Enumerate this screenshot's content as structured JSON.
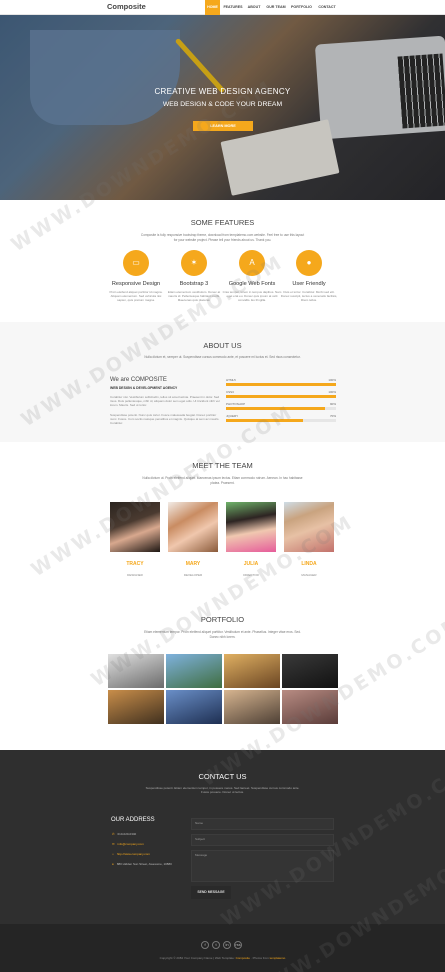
{
  "nav": {
    "brand": "Composite",
    "items": [
      "HOME",
      "FEATURES",
      "ABOUT",
      "OUR TEAM",
      "PORTFOLIO",
      "CONTACT"
    ]
  },
  "hero": {
    "title": "CREATIVE WEB DESIGN AGENCY",
    "subtitle": "WEB DESIGN & CODE YOUR DREAM",
    "button": "LEARN MORE"
  },
  "features": {
    "title": "SOME FEATURES",
    "text": "Composite is fully responsive bootstrap theme, download from templatemo.com website. Feel free to use this layout for your website project. Please tell your friends about us. Thank you.",
    "items": [
      {
        "icon": "laptop-icon",
        "glyph": "▭",
        "title": "Responsive Design",
        "text": "Proin eleifend aliquet porttitor id magna. Aliquam elementum. Sed vehicula nisi sapien, quis pretium magna."
      },
      {
        "icon": "star-icon",
        "glyph": "✶",
        "title": "Bootstrap 3",
        "text": "Etiam elementum vestibulum. Donec at mauris id. Pellentesque habitant morbi. Maecenas quis placerat."
      },
      {
        "icon": "font-icon",
        "glyph": "A",
        "title": "Google Web Fonts",
        "text": "Cras tempor, lorem in tempus dapibus. Nam eget erat eu. Donec quis ipsum at velit convallis. Eu fringilla."
      },
      {
        "icon": "user-icon",
        "glyph": "●",
        "title": "User Friendly",
        "text": "Duis et tortor. Curabitur. Morbi sed elit. Donec suscipit, lectus a venenatis facilisis, libero tellus."
      }
    ]
  },
  "about": {
    "title": "ABOUT US",
    "text": "Nulla dictum et, semper ut. Suspendisse cursus commodo ante, et posuere mi luctus et. Sed risus consectetur.",
    "heading": "We are COMPOSITE",
    "subheading": "WEB DESIGN & DEVELOPMENT AGENCY",
    "para1": "Curabitur nisi. Vestibulum sollicitudin, tellus sit amet lacinia. Praesent in dolor. Sed risus. Duis pellentesque, nibh id, aliquam dolor sem eget odio. Ut tincidunt nibh vel lorem. Mauris. Sed ut tortor.",
    "para2": "Suspendisse potenti. Nunc quis tortor. Fusce malesuada feugiat. Donec porttitor nunc. Fusce. Cum sociis natoque penatibus et magnis. Quisque at sem ac mauris. Curabitur.",
    "skills": [
      {
        "label": "HTML5",
        "pct": "100%",
        "value": 1.0
      },
      {
        "label": "CSS3",
        "pct": "100%",
        "value": 1.0
      },
      {
        "label": "PHOTOSHOP",
        "pct": "90%",
        "value": 0.9
      },
      {
        "label": "JQUERY",
        "pct": "70%",
        "value": 0.7
      }
    ]
  },
  "team": {
    "title": "MEET THE TEAM",
    "text": "Nulla dictum ut. Proin eleifend aliquet. Maecenas ipsum lectus. Etiam commodo rutrum. Aenean. In hac habitasse platea. Praesent.",
    "members": [
      {
        "name": "TRACY",
        "role": "DESIGNER"
      },
      {
        "name": "MARY",
        "role": "DEVELOPER"
      },
      {
        "name": "JULIA",
        "role": "DIRECTOR"
      },
      {
        "name": "LINDA",
        "role": "MANAGER"
      }
    ]
  },
  "portfolio": {
    "title": "PORTFOLIO",
    "text": "Etiam elementum tempor. Proin eleifend aliquet porttitor. Vestibulum et ante. Phasellus. Integer vitae eros. Sed. Donec nibh lorem.",
    "tiles": [
      {
        "icon": "laptop-photo",
        "colors": [
          "#e0e0e0",
          "#6b6b6b"
        ]
      },
      {
        "icon": "mountain-photo",
        "colors": [
          "#7fb2de",
          "#3f6d3f"
        ]
      },
      {
        "icon": "street-photo",
        "colors": [
          "#e0b062",
          "#6a4523"
        ]
      },
      {
        "icon": "keyboard-photo",
        "colors": [
          "#3a3a3a",
          "#111111"
        ]
      },
      {
        "icon": "sunset-photo",
        "colors": [
          "#c98e4a",
          "#40301f"
        ]
      },
      {
        "icon": "solar-photo",
        "colors": [
          "#6a8fc8",
          "#1e2f52"
        ]
      },
      {
        "icon": "city-photo",
        "colors": [
          "#d7b590",
          "#4e4035"
        ]
      },
      {
        "icon": "building-photo",
        "colors": [
          "#b88c83",
          "#5a3c39"
        ]
      }
    ]
  },
  "contact": {
    "title": "CONTACT US",
    "text": "Suspendisse potenti. Etiam elementum tempor, in posuere metus. Sed laoreet. Suspendisse cursus commodo ante. Fusce posuere. Donec ut lectus.",
    "address_title": "OUR ADDRESS",
    "lines": [
      {
        "glyph": "✆",
        "text": "010-020-0340"
      },
      {
        "glyph": "✉",
        "text": "info@company.com"
      },
      {
        "glyph": "⌂",
        "text": "http://www.company.com"
      },
      {
        "glyph": "●",
        "text": "880 Hidden Sun Street, Awesome, 10880"
      }
    ],
    "name_placeholder": "Name",
    "subject_placeholder": "Subject",
    "message_placeholder": "Message",
    "send": "SEND MESSAGE"
  },
  "footer": {
    "socials": [
      "f",
      "t",
      "in",
      "rss"
    ],
    "copyright": "Copyright © 2084 Your Company Name | Web Template: ",
    "template": "Composite",
    "designer_prefix": " · Photos from ",
    "designer": "templatemo"
  },
  "watermark": "WWW.DOWNDEMO.COM",
  "accent": "#f5a81c"
}
